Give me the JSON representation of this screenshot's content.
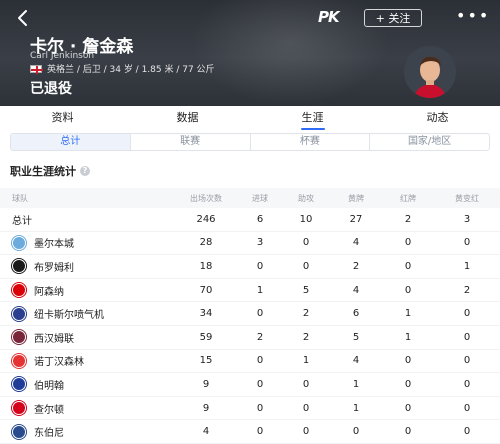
{
  "header": {
    "logo": "PK",
    "follow_label": "+ 关注",
    "more_label": "•••",
    "name_cn": "卡尔 · 詹金森",
    "name_en": "Carl Jenkinson",
    "info": "英格兰 / 后卫 / 34 岁 / 1.85 米 / 77 公斤",
    "status": "已退役",
    "colors": {
      "bg": "#2f343b",
      "accent": "#2e6cf5"
    }
  },
  "tabs": [
    "资料",
    "数据",
    "生涯",
    "动态"
  ],
  "active_tab": "生涯",
  "subtabs": [
    "总计",
    "联赛",
    "杯赛",
    "国家/地区"
  ],
  "active_subtab": "总计",
  "section_title": "职业生涯统计",
  "table": {
    "columns": [
      "球队",
      "出场次数",
      "进球",
      "助攻",
      "黄牌",
      "红牌",
      "黄变红"
    ],
    "total": {
      "label": "总计",
      "values": [
        "246",
        "6",
        "10",
        "27",
        "2",
        "3"
      ]
    },
    "rows": [
      {
        "team": "墨尔本城",
        "crest_color": "#6cabdd",
        "values": [
          "28",
          "3",
          "0",
          "4",
          "0",
          "0"
        ]
      },
      {
        "team": "布罗姆利",
        "crest_color": "#1a1a1a",
        "values": [
          "18",
          "0",
          "0",
          "2",
          "0",
          "1"
        ]
      },
      {
        "team": "阿森纳",
        "crest_color": "#db0007",
        "values": [
          "70",
          "1",
          "5",
          "4",
          "0",
          "2"
        ]
      },
      {
        "team": "纽卡斯尔喷气机",
        "crest_color": "#2a3f8f",
        "values": [
          "34",
          "0",
          "2",
          "6",
          "1",
          "0"
        ]
      },
      {
        "team": "西汉姆联",
        "crest_color": "#7a263a",
        "values": [
          "59",
          "2",
          "2",
          "5",
          "1",
          "0"
        ]
      },
      {
        "team": "诺丁汉森林",
        "crest_color": "#e53233",
        "values": [
          "15",
          "0",
          "1",
          "4",
          "0",
          "0"
        ]
      },
      {
        "team": "伯明翰",
        "crest_color": "#1f3c99",
        "values": [
          "9",
          "0",
          "0",
          "1",
          "0",
          "0"
        ]
      },
      {
        "team": "查尔顿",
        "crest_color": "#d4021d",
        "values": [
          "9",
          "0",
          "0",
          "1",
          "0",
          "0"
        ]
      },
      {
        "team": "东伯尼",
        "crest_color": "#2a4b8d",
        "values": [
          "4",
          "0",
          "0",
          "0",
          "0",
          "0"
        ]
      }
    ]
  }
}
